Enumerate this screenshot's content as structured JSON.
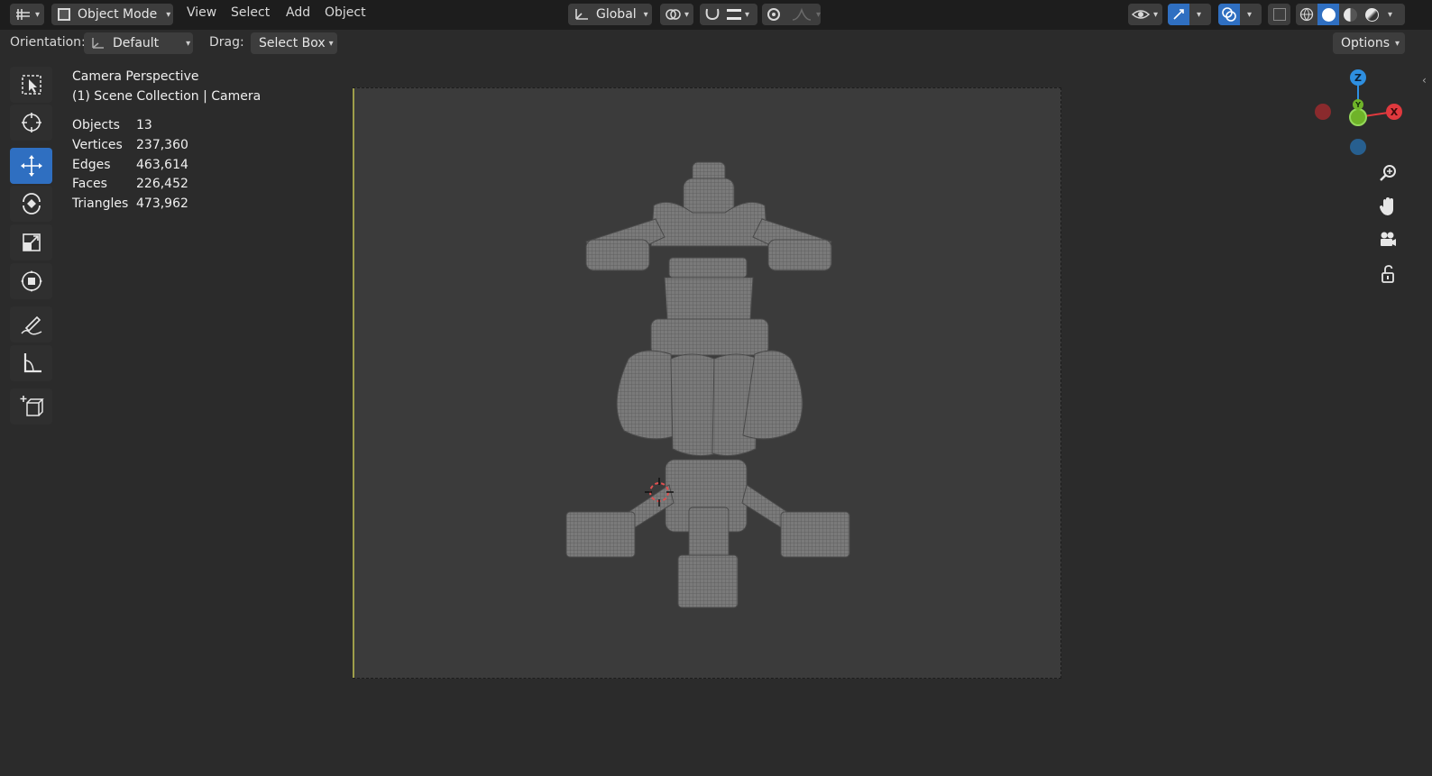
{
  "header": {
    "editor_type_icon": "editor-type-icon",
    "mode_label": "Object Mode",
    "menus": [
      "View",
      "Select",
      "Add",
      "Object"
    ],
    "transform_orientation": "Global"
  },
  "toolbar": {
    "orientation_label": "Orientation:",
    "orientation_value": "Default",
    "drag_label": "Drag:",
    "drag_value": "Select Box",
    "options_label": "Options"
  },
  "viewport_info": {
    "view_name": "Camera Perspective",
    "collection": "(1) Scene Collection | Camera"
  },
  "stats": [
    {
      "label": "Objects",
      "value": "13"
    },
    {
      "label": "Vertices",
      "value": "237,360"
    },
    {
      "label": "Edges",
      "value": "463,614"
    },
    {
      "label": "Faces",
      "value": "226,452"
    },
    {
      "label": "Triangles",
      "value": "473,962"
    }
  ],
  "gizmo": {
    "z_label": "Z",
    "y_label": "Y",
    "x_label": "X",
    "colors": {
      "x": "#e0393e",
      "y": "#6fb329",
      "z": "#2e8fe0"
    }
  },
  "colors": {
    "accent": "#2f6fc1",
    "header_bg": "#1d1d1d",
    "viewport_bg": "#2b2b2b"
  }
}
